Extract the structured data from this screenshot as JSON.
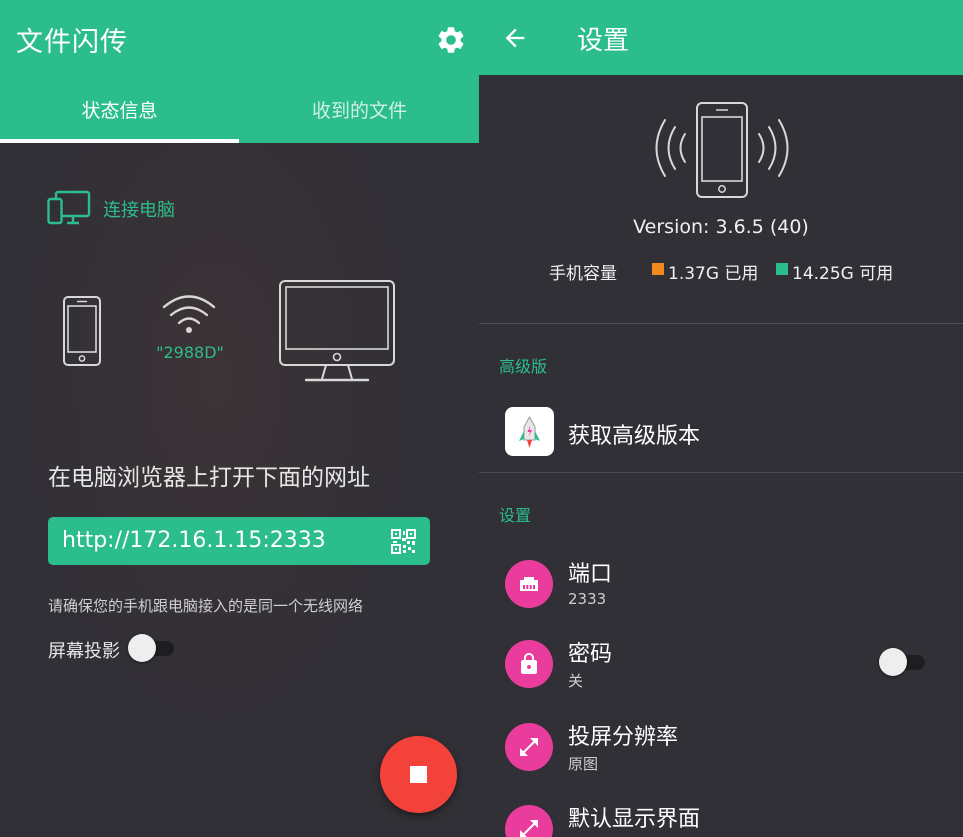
{
  "left_panel": {
    "app_title": "文件闪传",
    "tabs": [
      {
        "label": "状态信息",
        "active": true
      },
      {
        "label": "收到的文件",
        "active": false
      }
    ],
    "connect_label": "连接电脑",
    "wifi_ssid": "\"2988D\"",
    "instruction": "在电脑浏览器上打开下面的网址",
    "url": "http://172.16.1.15:2333",
    "hint": "请确保您的手机跟电脑接入的是同一个无线网络",
    "screen_mirror_label": "屏幕投影",
    "screen_mirror_on": false
  },
  "right_panel": {
    "title": "设置",
    "version": "Version: 3.6.5 (40)",
    "storage": {
      "label": "手机容量",
      "used": "1.37G 已用",
      "free": "14.25G 可用"
    },
    "sections": {
      "premium": "高级版",
      "settings": "设置"
    },
    "premium_item": "获取高级版本",
    "items": [
      {
        "title": "端口",
        "subtitle": "2333",
        "icon": "ethernet-port-icon"
      },
      {
        "title": "密码",
        "subtitle": "关",
        "icon": "lock-icon",
        "toggle_on": false
      },
      {
        "title": "投屏分辨率",
        "subtitle": "原图",
        "icon": "expand-arrows-icon"
      },
      {
        "title": "默认显示界面",
        "subtitle": "",
        "icon": "expand-arrows-icon"
      }
    ]
  },
  "colors": {
    "accent": "#2bbd8b",
    "background": "#303036",
    "fab": "#f2423a",
    "setting_icon": "#ea3c9c",
    "used_storage": "#f28a1d"
  }
}
